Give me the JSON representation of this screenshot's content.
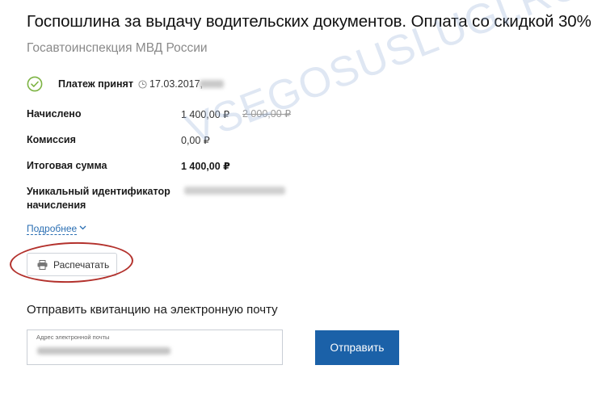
{
  "header": {
    "title": "Госпошлина за выдачу водительских документов. Оплата со скидкой 30%",
    "subtitle": "Госавтоинспекция МВД России"
  },
  "status": {
    "label": "Платеж принят",
    "date": "17.03.2017,",
    "icon": "check-circle-icon",
    "time_icon": "clock-icon"
  },
  "rows": [
    {
      "label": "Начислено",
      "value": "1 400,00 ₽",
      "old_value": "2 000,00 ₽"
    },
    {
      "label": "Комиссия",
      "value": "0,00 ₽"
    },
    {
      "label": "Итоговая сумма",
      "value": "1 400,00 ₽"
    },
    {
      "label": "Уникальный идентификатор начисления"
    }
  ],
  "details_link": "Подробнее",
  "print_button": {
    "label": "Распечатать",
    "icon": "printer-icon"
  },
  "watermark": "VSEGOSUSLUGI.RU",
  "email": {
    "title": "Отправить квитанцию на электронную почту",
    "placeholder": "Адрес электронной почты",
    "send_label": "Отправить"
  },
  "colors": {
    "accent": "#1b61a8",
    "link": "#2b6fb3",
    "success": "#7cb342",
    "annotation": "#b3312c"
  }
}
